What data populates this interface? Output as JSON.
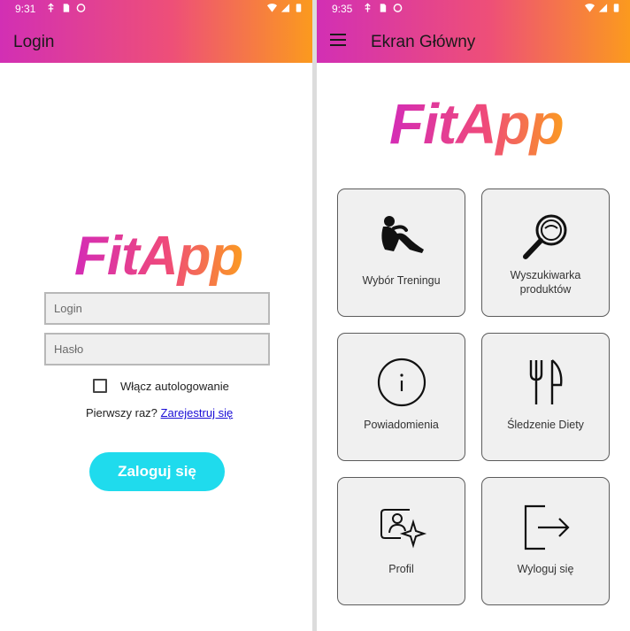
{
  "login_screen": {
    "status_time": "9:31",
    "title": "Login",
    "logo": "FitApp",
    "login_placeholder": "Login",
    "password_placeholder": "Hasło",
    "autologin_label": "Włącz autologowanie",
    "first_time_text": "Pierwszy raz?",
    "register_link": "Zarejestruj się",
    "login_button": "Zaloguj się",
    "accent_color": "#1fdbed"
  },
  "home_screen": {
    "status_time": "9:35",
    "title": "Ekran Główny",
    "logo": "FitApp",
    "tiles": [
      {
        "label": "Wybór Treningu",
        "icon": "workout-situp-icon"
      },
      {
        "label": "Wyszukiwarka produktów",
        "icon": "magnifier-icon"
      },
      {
        "label": "Powiadomienia",
        "icon": "info-icon"
      },
      {
        "label": "Śledzenie Diety",
        "icon": "fork-knife-icon"
      },
      {
        "label": "Profil",
        "icon": "profile-card-icon"
      },
      {
        "label": "Wyloguj się",
        "icon": "logout-icon"
      }
    ]
  },
  "status_icons": [
    "wifi-icon",
    "signal-icon",
    "battery-icon"
  ],
  "brand_gradient": [
    "#d22fb4",
    "#ee4f78",
    "#fb9a1e"
  ]
}
